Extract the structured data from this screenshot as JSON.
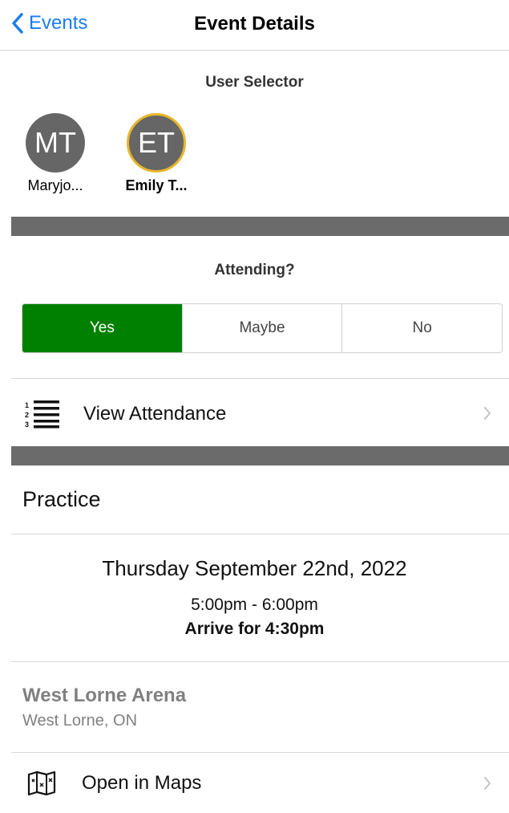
{
  "nav": {
    "back_label": "Events",
    "title": "Event Details"
  },
  "user_selector": {
    "title": "User Selector",
    "users": [
      {
        "initials": "MT",
        "name": "Maryjo...",
        "selected": false
      },
      {
        "initials": "ET",
        "name": "Emily T...",
        "selected": true
      }
    ]
  },
  "attending": {
    "title": "Attending?",
    "options": [
      "Yes",
      "Maybe",
      "No"
    ],
    "selected": "Yes"
  },
  "view_attendance": {
    "label": "View Attendance"
  },
  "event": {
    "type": "Practice",
    "date": "Thursday September 22nd, 2022",
    "time": "5:00pm - 6:00pm",
    "arrive": "Arrive for 4:30pm"
  },
  "location": {
    "venue": "West Lorne Arena",
    "city": "West Lorne, ON"
  },
  "maps": {
    "label": "Open in Maps"
  },
  "colors": {
    "accent": "#1a7cf0",
    "selected_green": "#008000",
    "avatar_ring": "#e8b62c",
    "divider": "#6b6b6b"
  }
}
